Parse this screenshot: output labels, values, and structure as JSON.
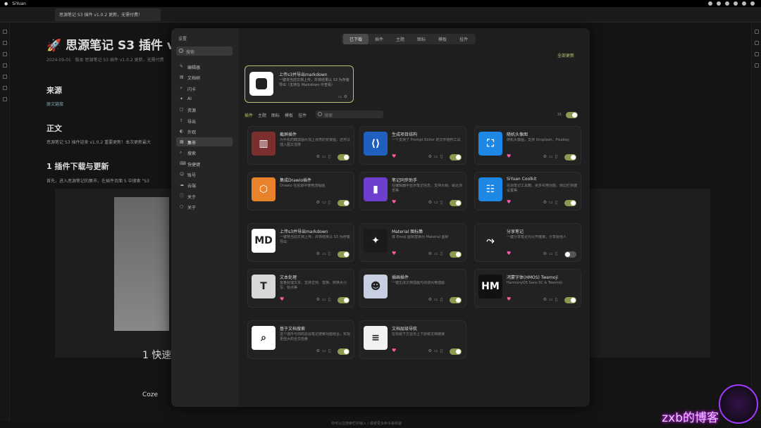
{
  "os": {
    "app_name": "SiYuan"
  },
  "editor": {
    "tab_title": "思源笔记 S3 插件 v1.0.2 更新，无需付费！",
    "doc_title": "🚀 思源笔记 S3 插件 v",
    "meta_date": "2024-09-01",
    "meta_desc": "版本 思源笔记 S3 插件 v1.0.2 更新，无需付费",
    "h_source": "来源",
    "source_link": "原文链接",
    "h_body": "正文",
    "body_text": "思源笔记 S3 插件迎来 v1.0.2 重要更新！本次更新最大",
    "h_download": "1 插件下载与更新",
    "download_text": "首先，进入思源笔记的集市，在插件页面 S 中搜索 \"S3",
    "quick_title": "1 快速",
    "coze_label": "Coze",
    "footer_hint": "你可以在搜索栏中输入 / 或者更多命令来快速",
    "watermark": "zxb的博客"
  },
  "settings": {
    "title": "设置",
    "search_placeholder": "搜索",
    "nav": [
      {
        "label": "编辑器",
        "icon": "✎"
      },
      {
        "label": "文档树",
        "icon": "▤"
      },
      {
        "label": "闪卡",
        "icon": "⚡"
      },
      {
        "label": "AI",
        "icon": "✦"
      },
      {
        "label": "资源",
        "icon": "▢"
      },
      {
        "label": "导出",
        "icon": "⇪"
      },
      {
        "label": "外观",
        "icon": "◐"
      },
      {
        "label": "集市",
        "icon": "▦",
        "active": true
      },
      {
        "label": "搜索",
        "icon": "⌕"
      },
      {
        "label": "快捷键",
        "icon": "⌨"
      },
      {
        "label": "账号",
        "icon": "☺"
      },
      {
        "label": "云端",
        "icon": "☁"
      },
      {
        "label": "关于",
        "icon": "ⓘ"
      },
      {
        "label": "关于",
        "icon": "○"
      }
    ],
    "top_tabs": [
      {
        "label": "已下载",
        "active": true
      },
      {
        "label": "插件"
      },
      {
        "label": "主题"
      },
      {
        "label": "图标"
      },
      {
        "label": "模板"
      },
      {
        "label": "挂件"
      }
    ],
    "update_all": "全部更新",
    "featured": {
      "name": "上传s3并导出markdown",
      "desc": "一键将当前文档上传，并将结果以 S3 为存储导出（支持在 Markdown 中查看）"
    },
    "filters": [
      {
        "label": "插件",
        "active": true
      },
      {
        "label": "主题"
      },
      {
        "label": "图标"
      },
      {
        "label": "模板"
      },
      {
        "label": "挂件"
      }
    ],
    "filter_search_placeholder": "搜索",
    "count": "16",
    "cards": [
      {
        "name": "截屏插件",
        "desc": "为手机的截屏图片加上漂亮的背景图，还可以插入图文混排",
        "color": "#7a2e2e",
        "glyph": "▥",
        "heart": false,
        "toggle": true
      },
      {
        "name": "生成项目结构",
        "desc": "一个支持了 Prompt Editor 的文件结构工具",
        "color": "#1e5fbf",
        "glyph": "⟨⟩",
        "heart": true,
        "toggle": true
      },
      {
        "name": "随机头像图",
        "desc": "随机头像图，支持 Unsplash，Pixabay",
        "color": "#1d88e5",
        "glyph": "⛶",
        "heart": true,
        "toggle": true
      },
      {
        "name": "集成Drawio插件",
        "desc": "Drawio 在思源中使用流程图",
        "color": "#e8832b",
        "glyph": "⬡",
        "heart": false,
        "toggle": true
      },
      {
        "name": "笔记同步助手",
        "desc": "在编辑器中显示笔记信息，支持大纲，最近浏览等",
        "color": "#6c3fcf",
        "glyph": "▮",
        "heart": true,
        "toggle": true
      },
      {
        "name": "SiYuan Coolkit",
        "desc": "思源笔记工具箱，更多实用功能，侧边栏快捷设置等",
        "color": "#1d88e5",
        "glyph": "☷",
        "heart": true,
        "toggle": true
      },
      {
        "name": "上传s3并导出markdown",
        "desc": "一键将当前文档上传，并将结果以 S3 为存储导出",
        "color": "#ffffff",
        "glyph": "MD",
        "heart": false,
        "toggle": true
      },
      {
        "name": "Material 图标集",
        "desc": "将 Emoji 图标替换为 Material 图标",
        "color": "#1b1b1b",
        "glyph": "✦",
        "heart": true,
        "toggle": true
      },
      {
        "name": "分享笔记",
        "desc": "一键分享笔记为公开链接，分享给他人",
        "color": "#222222",
        "glyph": "⤳",
        "heart": true,
        "toggle": false
      },
      {
        "name": "文本处理",
        "desc": "批量处理文本，支持正则、替换、转换大小写、标点等",
        "color": "#d8d8d8",
        "glyph": "T",
        "heart": true,
        "toggle": true
      },
      {
        "name": "插画插件",
        "desc": "一键生成文档插画与动漫风格插图",
        "color": "#c7cfe0",
        "glyph": "☻",
        "heart": false,
        "toggle": true
      },
      {
        "name": "鸿蒙字体(HMOS) Twemoji",
        "desc": "HarmonyOS Sans SC & Twemoji",
        "color": "#111111",
        "glyph": "HM",
        "heart": true,
        "toggle": true
      },
      {
        "name": "基于文档搜索",
        "desc": "这个插件与你的思源笔记搜索功能结合，实现更强大的全文检索",
        "color": "#ffffff",
        "glyph": "⌕",
        "heart": false,
        "toggle": true
      },
      {
        "name": "文档层级导航",
        "desc": "在标题下方显示上下层级文档链接",
        "color": "#f2f2f2",
        "glyph": "≡",
        "heart": true,
        "toggle": true
      }
    ]
  }
}
